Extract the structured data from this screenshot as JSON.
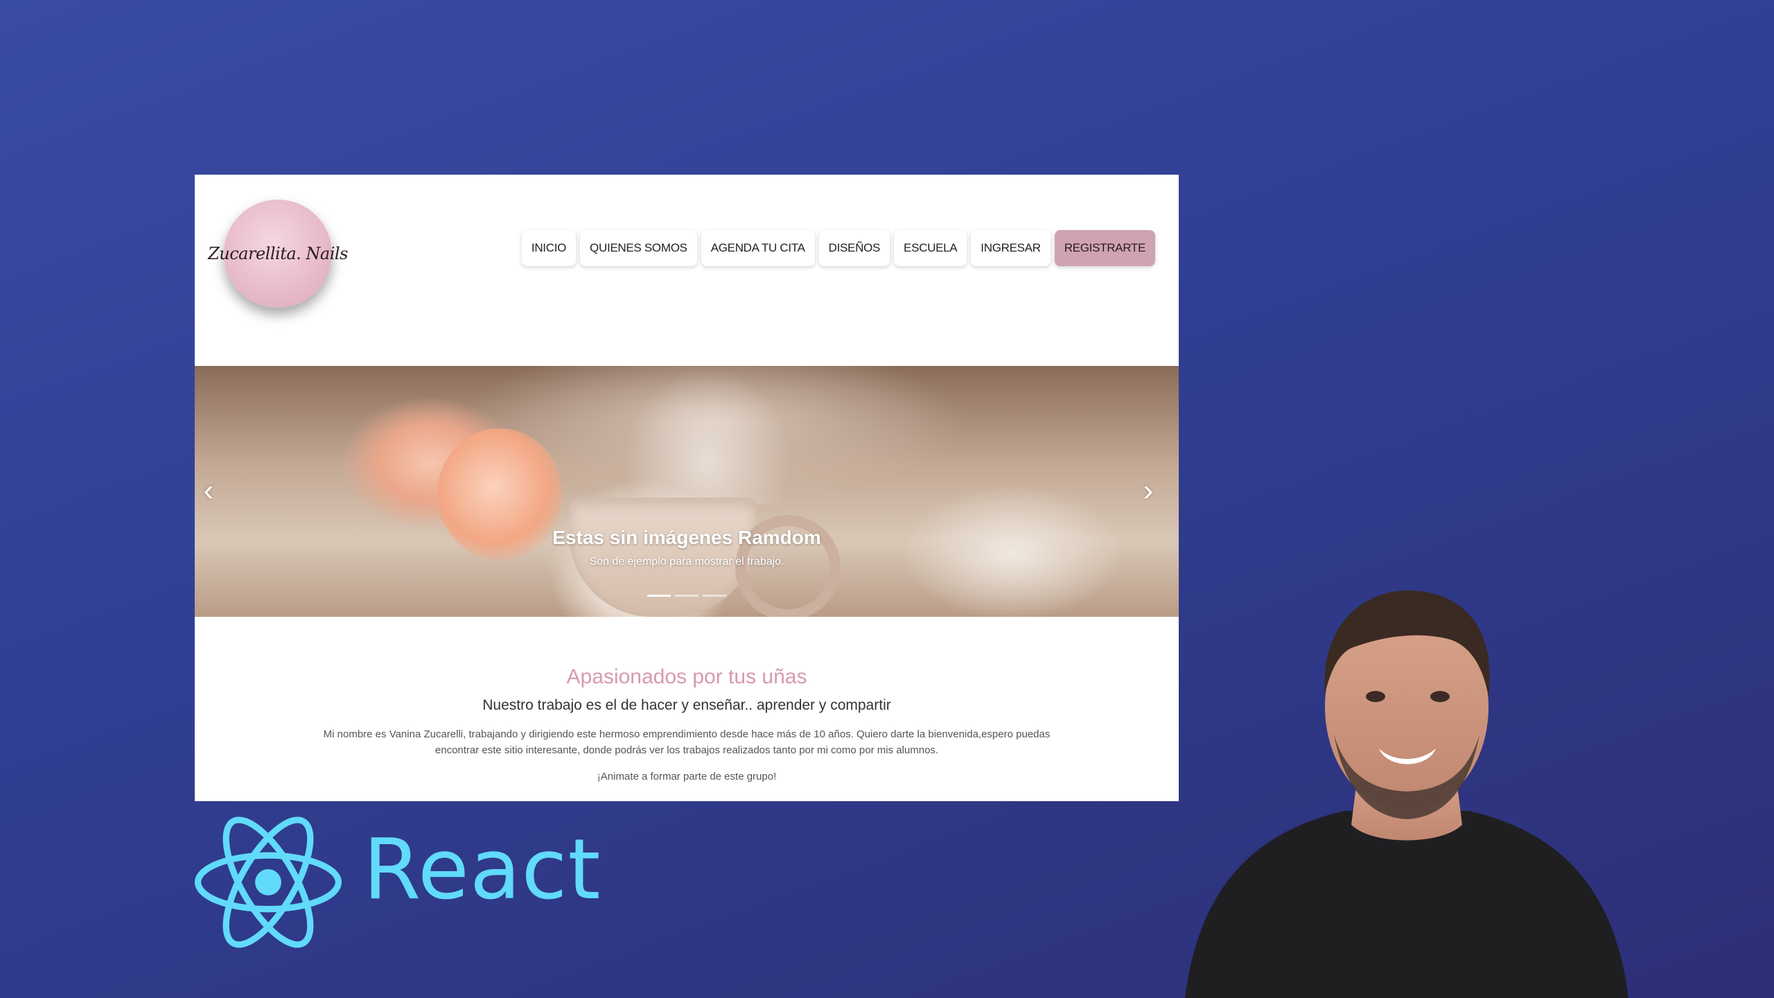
{
  "site": {
    "logo_text": "Zucarellita. Nails",
    "nav": [
      {
        "label": "INICIO"
      },
      {
        "label": "QUIENES SOMOS"
      },
      {
        "label": "AGENDA TU CITA"
      },
      {
        "label": "DISEÑOS"
      },
      {
        "label": "ESCUELA"
      },
      {
        "label": "INGRESAR"
      },
      {
        "label": "REGISTRARTE"
      }
    ],
    "carousel": {
      "prev_glyph": "‹",
      "next_glyph": "›",
      "caption_title": "Estas sin imágenes Ramdom",
      "caption_text": "Son de ejemplo para mostrar el trabajo."
    },
    "about": {
      "title": "Apasionados por tus uñas",
      "subtitle": "Nuestro trabajo es el de hacer y enseñar.. aprender y compartir",
      "body": "Mi nombre es Vanina Zucarelli, trabajando y dirigiendo este hermoso emprendimiento desde hace más de 10 años. Quiero darte la bienvenida,espero puedas encontrar este sitio interesante, donde podrás ver los trabajos realizados tanto por mi como por mis alumnos.",
      "cta": "¡Animate a formar parte de este grupo!"
    }
  },
  "brand": {
    "react_word": "React",
    "react_color": "#61dafb"
  },
  "colors": {
    "accent_pink": "#cfa3b1",
    "title_pink": "#d79aaa",
    "background": "#303f92"
  },
  "icons": {
    "react": "react-atom-icon",
    "prev": "chevron-left-icon",
    "next": "chevron-right-icon"
  }
}
